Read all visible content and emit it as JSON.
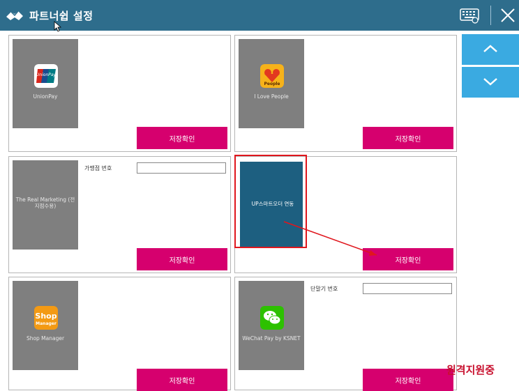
{
  "window": {
    "title": "파트너쉽 설정",
    "icons": {
      "logo": "handshake-icon",
      "keyboard": "keyboard-icon",
      "close": "close-icon"
    }
  },
  "cards": [
    {
      "name": "unionpay",
      "thumb_caption": "UnionPay",
      "icon": "unionpay-logo",
      "save_label": "저장확인"
    },
    {
      "name": "ilovepeople",
      "thumb_caption": "I Love People",
      "icon": "ilovepeople-logo",
      "save_label": "저장확인"
    },
    {
      "name": "the-real-marketing",
      "thumb_caption": "The Real Marketing (전 지점수용)",
      "field_label": "가맹점 번호",
      "field_value": "",
      "save_label": "저장확인"
    },
    {
      "name": "up-smart-order",
      "thumb_caption": "UP스마트오더 연동",
      "save_label": "저장확인"
    },
    {
      "name": "shop-manager",
      "thumb_caption": "Shop Manager",
      "icon": "shopmanager-logo",
      "save_label": "저장확인"
    },
    {
      "name": "wechat-pay",
      "thumb_caption": "WeChat Pay by KSNET",
      "icon": "wechat-logo",
      "field_label": "단말기 번호",
      "field_value": "",
      "save_label": "저장확인"
    }
  ],
  "scroll": {
    "up_icon": "chevron-up-icon",
    "down_icon": "chevron-down-icon"
  },
  "overlay": {
    "remote_support": "원격지원중"
  },
  "colors": {
    "titlebar": "#2e6d8c",
    "save_button": "#d6006e",
    "scroll_button": "#3aaae1",
    "highlight": "#e0161d"
  }
}
